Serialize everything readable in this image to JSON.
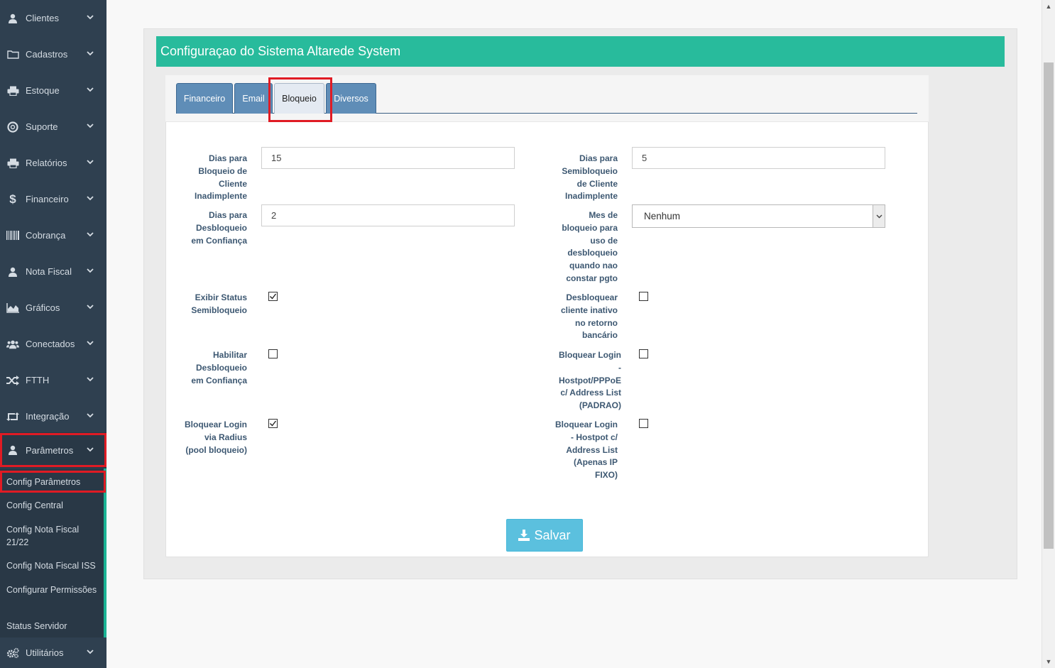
{
  "sidebar": {
    "items": [
      {
        "label": "Clientes",
        "icon": "user-icon"
      },
      {
        "label": "Cadastros",
        "icon": "folder-icon"
      },
      {
        "label": "Estoque",
        "icon": "printer-icon"
      },
      {
        "label": "Suporte",
        "icon": "life-ring-icon"
      },
      {
        "label": "Relatórios",
        "icon": "printer-icon"
      },
      {
        "label": "Financeiro",
        "icon": "dollar-icon"
      },
      {
        "label": "Cobrança",
        "icon": "barcode-icon"
      },
      {
        "label": "Nota Fiscal",
        "icon": "user-icon"
      },
      {
        "label": "Gráficos",
        "icon": "area-chart-icon"
      },
      {
        "label": "Conectados",
        "icon": "users-icon"
      },
      {
        "label": "FTTH",
        "icon": "random-icon"
      },
      {
        "label": "Integração",
        "icon": "retweet-icon"
      },
      {
        "label": "Parâmetros",
        "icon": "user-icon"
      },
      {
        "label": "Utilitários",
        "icon": "cogs-icon"
      }
    ],
    "subitems": [
      {
        "label": "Config Parâmetros"
      },
      {
        "label": "Config Central"
      },
      {
        "label": "Config Nota Fiscal 21/22"
      },
      {
        "label": "Config Nota Fiscal ISS"
      },
      {
        "label": "Configurar Permissões"
      },
      {
        "label": "Status Servidor"
      }
    ]
  },
  "page": {
    "title": "Configuraçao do Sistema Altarede System"
  },
  "tabs": [
    "Financeiro",
    "Email",
    "Bloqueio",
    "Diversos"
  ],
  "active_tab": "Bloqueio",
  "form": {
    "dias_bloqueio_label": "Dias para Bloqueio de Cliente Inadimplente",
    "dias_bloqueio_value": "15",
    "dias_semibloqueio_label": "Dias para Semibloqueio de Cliente Inadimplente",
    "dias_semibloqueio_value": "5",
    "dias_desbloqueio_label": "Dias para Desbloqueio em Confiança",
    "dias_desbloqueio_value": "2",
    "mes_bloqueio_label": "Mes de bloqueio para uso de desbloqueio quando nao constar pgto",
    "mes_bloqueio_value": "Nenhum",
    "exibir_status_label": "Exibir Status Semibloqueio",
    "exibir_status_checked": true,
    "desbloquear_inativo_label": "Desbloquear cliente inativo no retorno bancário",
    "desbloquear_inativo_checked": false,
    "habilitar_desbloqueio_label": "Habilitar Desbloqueio em Confiança",
    "habilitar_desbloqueio_checked": false,
    "bloquear_hostpot_pppoe_label": "Bloquear Login - Hostpot/PPPoE c/ Address List (PADRAO)",
    "bloquear_hostpot_pppoe_checked": false,
    "bloquear_radius_label": "Bloquear Login via Radius (pool bloqueio)",
    "bloquear_radius_checked": true,
    "bloquear_hostpot_ip_label": "Bloquear Login - Hostpot c/ Address List (Apenas IP FIXO)",
    "bloquear_hostpot_ip_checked": false
  },
  "save_button": {
    "label": "Salvar",
    "icon": "download-icon"
  },
  "colors": {
    "sidebar_bg": "#2f4050",
    "header_bg": "#28bb9c",
    "tab_bg": "#5f8db7",
    "button_bg": "#5bc0de",
    "highlight": "#e01b24",
    "accent": "#1ab394"
  }
}
